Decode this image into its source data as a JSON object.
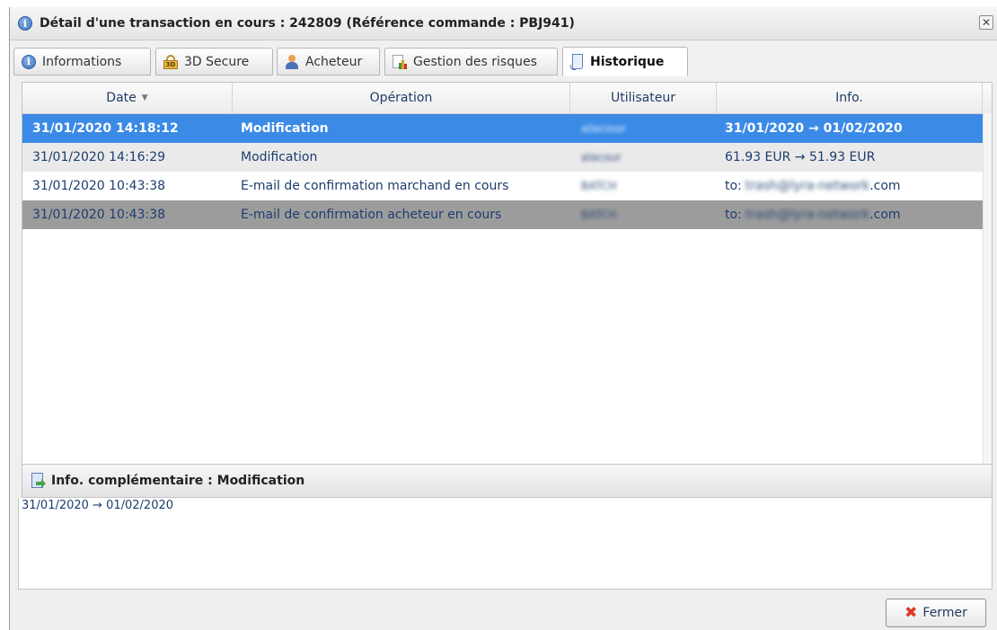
{
  "window": {
    "title": "Détail d'une transaction en cours : 242809 (Référence commande : PBJ941)",
    "close_symbol": "✕"
  },
  "tabs": [
    {
      "label": "Informations",
      "icon": "info-icon"
    },
    {
      "label": "3D Secure",
      "icon": "lock-icon",
      "icon_text": "3D"
    },
    {
      "label": "Acheteur",
      "icon": "user-icon"
    },
    {
      "label": "Gestion des risques",
      "icon": "chart-icon"
    },
    {
      "label": "Historique",
      "icon": "document-icon",
      "active": true
    }
  ],
  "grid": {
    "columns": [
      "Date",
      "Opération",
      "Utilisateur",
      "Info."
    ],
    "sort_indicator": "▼",
    "rows": [
      {
        "date": "31/01/2020 14:18:12",
        "operation": "Modification",
        "user": "alacour",
        "info": "31/01/2020 → 01/02/2020",
        "state": "selected"
      },
      {
        "date": "31/01/2020 14:16:29",
        "operation": "Modification",
        "user": "alacour",
        "info": "61.93 EUR → 51.93 EUR",
        "state": "alt"
      },
      {
        "date": "31/01/2020 10:43:38",
        "operation": "E-mail de confirmation marchand en cours",
        "user": "BATCH",
        "info_prefix": "to: ",
        "info_hidden": "trash@lyra-network",
        "info_suffix": ".com",
        "state": "plain"
      },
      {
        "date": "31/01/2020 10:43:38",
        "operation": "E-mail de confirmation acheteur en cours",
        "user": "BATCH",
        "info_prefix": "to: ",
        "info_hidden": "trash@lyra-network",
        "info_suffix": ".com",
        "state": "hover"
      }
    ]
  },
  "extra": {
    "title": "Info. complémentaire : Modification",
    "content": "31/01/2020 → 01/02/2020"
  },
  "footer": {
    "close_button": "Fermer",
    "close_symbol": "✖"
  },
  "colors": {
    "selected_row": "#3a8ae6",
    "alt_row": "#eaeaea",
    "hover_row": "#9c9c9c",
    "link_text": "#1d3d6e",
    "close_mark": "#e0382c"
  }
}
